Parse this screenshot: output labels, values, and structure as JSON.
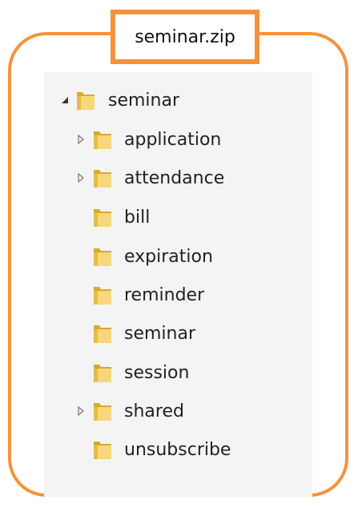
{
  "title": "seminar.zip",
  "colors": {
    "accent": "#f4923c",
    "panel": "#f4f4f4",
    "folder_light": "#f7d77a",
    "folder_dark": "#d9a92c"
  },
  "tree": {
    "root": {
      "label": "seminar",
      "state": "expanded",
      "icon": "folder-icon"
    },
    "children": [
      {
        "label": "application",
        "state": "collapsed",
        "icon": "folder-icon"
      },
      {
        "label": "attendance",
        "state": "collapsed",
        "icon": "folder-icon"
      },
      {
        "label": "bill",
        "state": "none",
        "icon": "folder-icon"
      },
      {
        "label": "expiration",
        "state": "none",
        "icon": "folder-icon"
      },
      {
        "label": "reminder",
        "state": "none",
        "icon": "folder-icon"
      },
      {
        "label": "seminar",
        "state": "none",
        "icon": "folder-icon"
      },
      {
        "label": "session",
        "state": "none",
        "icon": "folder-icon"
      },
      {
        "label": "shared",
        "state": "collapsed",
        "icon": "folder-icon"
      },
      {
        "label": "unsubscribe",
        "state": "none",
        "icon": "folder-icon"
      }
    ]
  }
}
